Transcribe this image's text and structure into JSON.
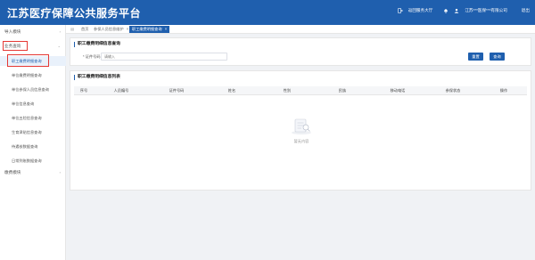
{
  "header": {
    "title": "江苏医疗保障公共服务平台",
    "return_link": "返回服务大厅",
    "org_name": "江苏***医保***有限公司",
    "logout": "退出"
  },
  "sidebar": {
    "groups": [
      {
        "label": "导入模块"
      },
      {
        "label": "业务查询"
      },
      {
        "label": "缴费模块"
      }
    ],
    "items": [
      {
        "label": "职工缴费明细查询"
      },
      {
        "label": "单位缴费明细查询"
      },
      {
        "label": "单位参保人员信息查询"
      },
      {
        "label": "单位信息查询"
      },
      {
        "label": "单位五险信息查询"
      },
      {
        "label": "生育津贴信息查询"
      },
      {
        "label": "待遇核数据查询"
      },
      {
        "label": "日常到账数据查询"
      }
    ]
  },
  "tabs": [
    {
      "label": "首页"
    },
    {
      "label": "参保人员信息维护"
    },
    {
      "label": "职工缴费明细查询"
    }
  ],
  "search_panel": {
    "title": "职工缴费明细信息查询",
    "field_label": "* 证件号码",
    "field_placeholder": "请输入",
    "reset_label": "重置",
    "query_label": "查询"
  },
  "table_panel": {
    "title": "职工缴费明细信息列表",
    "columns": [
      "序号",
      "人员编号",
      "证件号码",
      "姓名",
      "性别",
      "民族",
      "移动电话",
      "参保状态",
      "操作"
    ],
    "empty_text": "暂无内容"
  },
  "colors": {
    "primary": "#1f5fae",
    "highlight": "#e53935"
  }
}
